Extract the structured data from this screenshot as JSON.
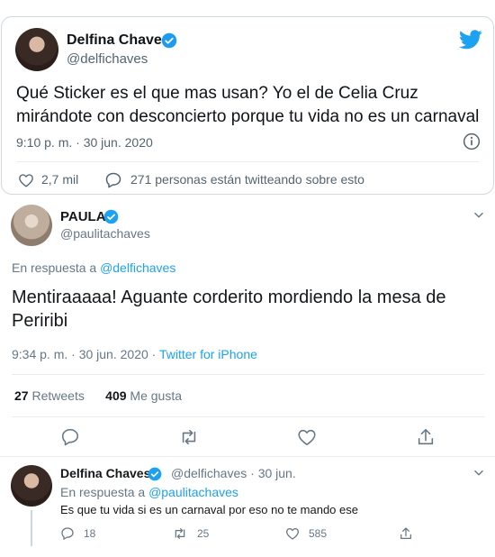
{
  "embed": {
    "name": "Delfina Chaves",
    "handle": "@delfichaves",
    "text": "Qué Sticker es el que mas usan? Yo el de Celia Cruz mirándote con desconcierto porque tu vida no es un carnaval",
    "time": "9:10 p. m. · 30 jun. 2020",
    "likes": "2,7 mil",
    "conversation": "271 personas están twitteando sobre esto",
    "icons": [
      "verified-icon",
      "twitter-bird-icon",
      "info-icon",
      "heart-icon",
      "comment-icon"
    ],
    "colors": {
      "accent": "#1da1f2",
      "verified": "#1d9bf0"
    }
  },
  "main": {
    "name": "PAULA",
    "handle": "@paulitachaves",
    "reply_prefix": "En respuesta a",
    "reply_to": "@delfichaves",
    "text": "Mentiraaaaa! Aguante corderito mordiendo la mesa de Periribi",
    "time": "9:34 p. m. · 30 jun. 2020 · ",
    "source": "Twitter for iPhone",
    "retweets": "27",
    "retweets_label": "Retweets",
    "likes": "409",
    "likes_label": "Me gusta"
  },
  "reply": {
    "name": "Delfina Chaves",
    "meta": "@delfichaves · 30 jun.",
    "reply_prefix": "En respuesta a",
    "reply_to": "@paulitachaves",
    "text": "Es que tu vida si es un carnaval por eso no te mando ese",
    "replies": "18",
    "retweets": "25",
    "likes": "585"
  }
}
